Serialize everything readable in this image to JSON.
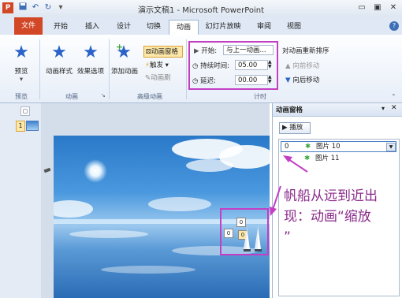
{
  "window": {
    "title": "演示文稿1 - Microsoft PowerPoint",
    "app_icon": "P"
  },
  "quick_access": {
    "save": "save-icon",
    "undo": "↶",
    "redo": "↻",
    "customize": "▾"
  },
  "tabs": [
    "文件",
    "开始",
    "插入",
    "设计",
    "切换",
    "动画",
    "幻灯片放映",
    "审阅",
    "视图"
  ],
  "active_tab": "动画",
  "ribbon": {
    "preview": {
      "label": "预览",
      "group": "预览"
    },
    "animation": {
      "styles_label": "动画样式",
      "effects_label": "效果选项",
      "group": "动画"
    },
    "advanced": {
      "add_label": "添加动画",
      "pane_btn": "动画窗格",
      "trigger": "触发",
      "painter": "动画刷",
      "group": "高级动画"
    },
    "timing": {
      "start_label": "开始:",
      "start_value": "与上一动画...",
      "duration_label": "持续时间:",
      "duration_value": "05.00",
      "delay_label": "延迟:",
      "delay_value": "00.00",
      "reorder_title": "对动画重新排序",
      "move_earlier": "向前移动",
      "move_later": "向后移动",
      "group": "计时"
    }
  },
  "thumbnails": {
    "slide_number": "1"
  },
  "pane": {
    "title": "动画窗格",
    "play_label": "播放",
    "items": [
      {
        "index": "0",
        "name": "图片 10"
      },
      {
        "index": "",
        "name": "图片 11"
      }
    ]
  },
  "slide_tags": {
    "tag_a": "0",
    "tag_b": "0",
    "tag_c": "0"
  },
  "annotation": {
    "line1": "帆船从远到近出",
    "line2": "现：动画“缩放",
    "line3": "”"
  },
  "colors": {
    "highlight": "#c43ec4",
    "file_tab": "#d24726",
    "accent": "#2a63c8"
  }
}
